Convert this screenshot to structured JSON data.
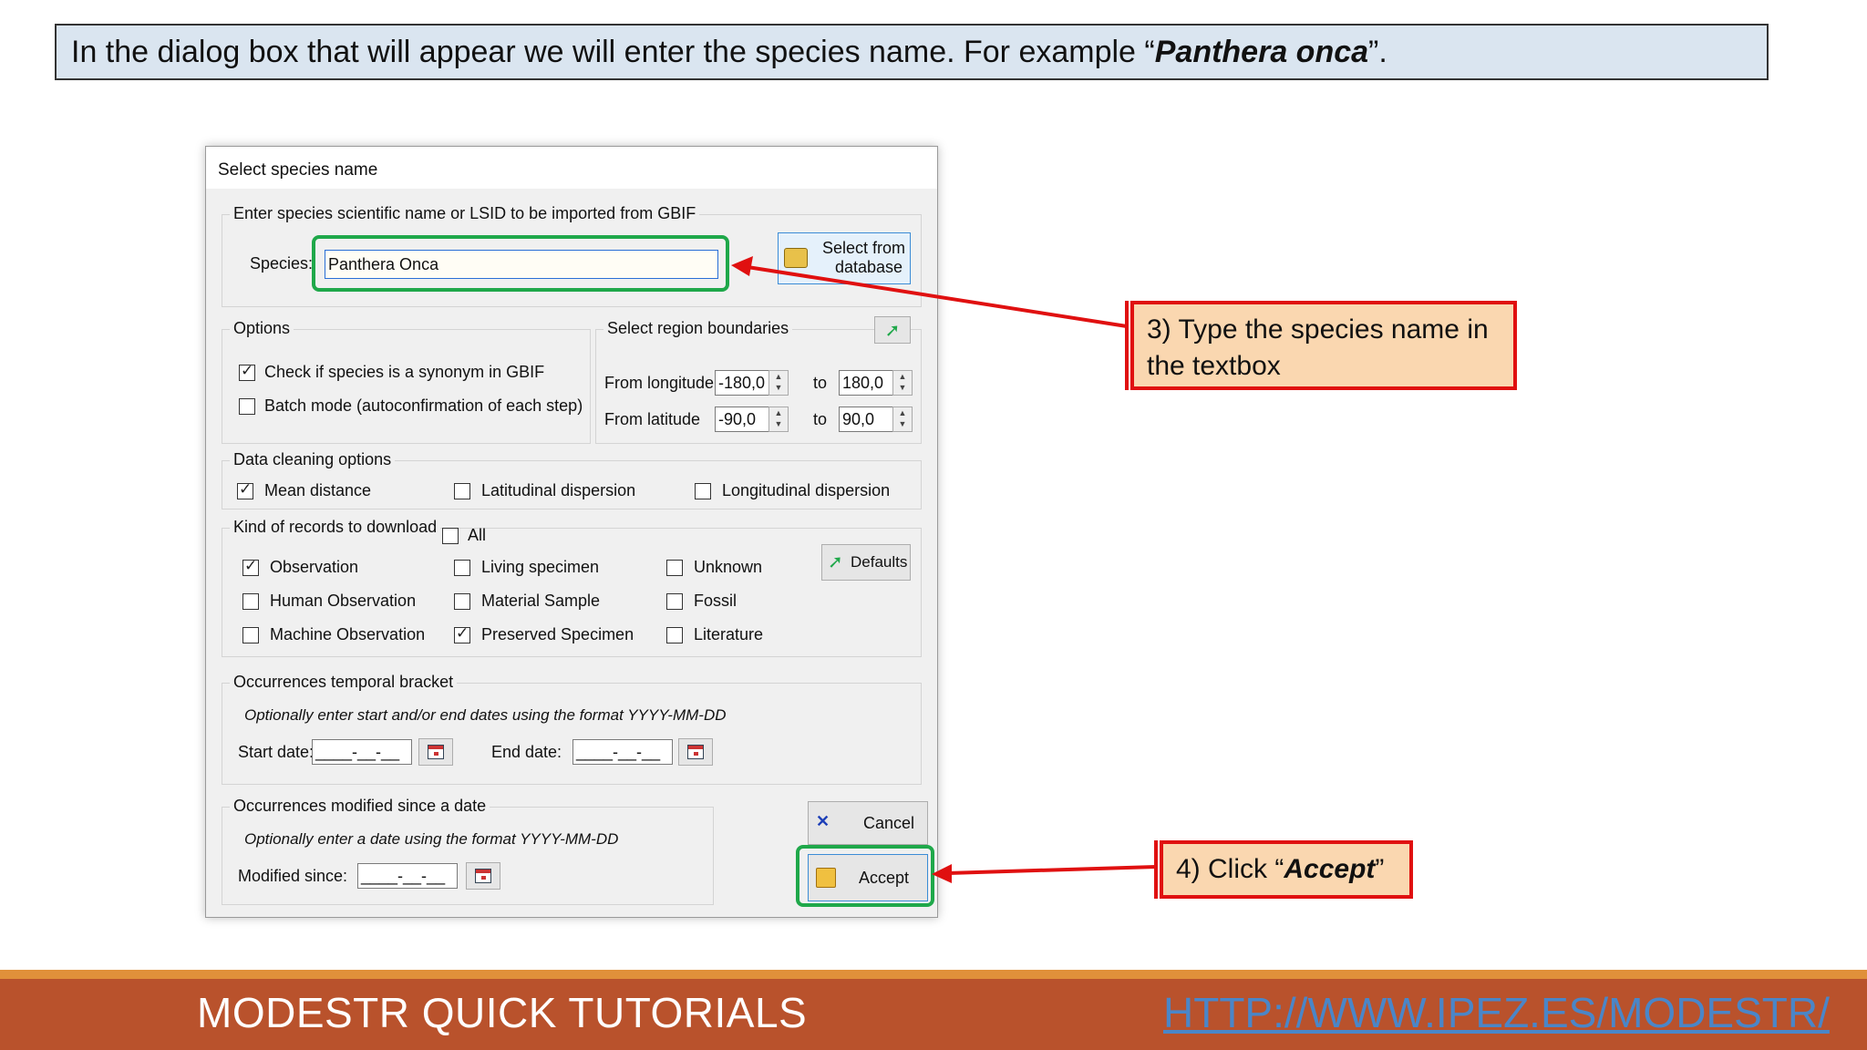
{
  "banner": {
    "prefix": "In the dialog box that will appear we will enter the species name. For example “",
    "species_example": "Panthera onca",
    "suffix": "”."
  },
  "dialog": {
    "title": "Select species name",
    "species_group": {
      "legend": "Enter species scientific name or LSID to be imported from GBIF",
      "species_label": "Species:",
      "species_value": "Panthera Onca",
      "select_db_line1": "Select from",
      "select_db_line2": "database"
    },
    "options": {
      "legend": "Options",
      "synonym_label": "Check if species is a synonym in GBIF",
      "synonym_checked": true,
      "batch_label": "Batch mode (autoconfirmation of each step)",
      "batch_checked": false
    },
    "region": {
      "legend": "Select region boundaries",
      "from_longitude_label": "From longitude",
      "from_longitude": "-180,0",
      "to_label": "to",
      "to_longitude": "180,0",
      "from_latitude_label": "From latitude",
      "from_latitude": "-90,0",
      "to_latitude": "90,0"
    },
    "cleaning": {
      "legend": "Data cleaning options",
      "mean_distance": "Mean distance",
      "latitudinal": "Latitudinal dispersion",
      "longitudinal": "Longitudinal dispersion"
    },
    "records": {
      "legend": "Kind of records to download",
      "all": "All",
      "observation": "Observation",
      "human_observation": "Human Observation",
      "machine_observation": "Machine Observation",
      "living_specimen": "Living specimen",
      "material_sample": "Material Sample",
      "preserved_specimen": "Preserved Specimen",
      "unknown": "Unknown",
      "fossil": "Fossil",
      "literature": "Literature",
      "defaults_button": "Defaults"
    },
    "temporal": {
      "legend": "Occurrences temporal bracket",
      "hint": "Optionally enter start and/or end dates using the format YYYY-MM-DD",
      "start_label": "Start date:",
      "start_value": "____-__-__",
      "end_label": "End date:",
      "end_value": "____-__-__"
    },
    "modified": {
      "legend": "Occurrences modified since a date",
      "hint": "Optionally enter a date using the format YYYY-MM-DD",
      "modified_label": "Modified since:",
      "modified_value": "____-__-__"
    },
    "cancel_button": "Cancel",
    "accept_button": "Accept"
  },
  "callouts": {
    "step3": "3) Type the species name in the textbox",
    "step4_prefix": "4) Click “",
    "step4_bold": "Accept",
    "step4_suffix": "”"
  },
  "footer": {
    "title": "MODESTR QUICK TUTORIALS",
    "link": "HTTP://WWW.IPEZ.ES/MODESTR/"
  },
  "colors": {
    "annotation_red": "#e01010",
    "highlight_green": "#1fa84a",
    "footer_bg": "#b9522c",
    "footer_accent": "#e0903a"
  }
}
